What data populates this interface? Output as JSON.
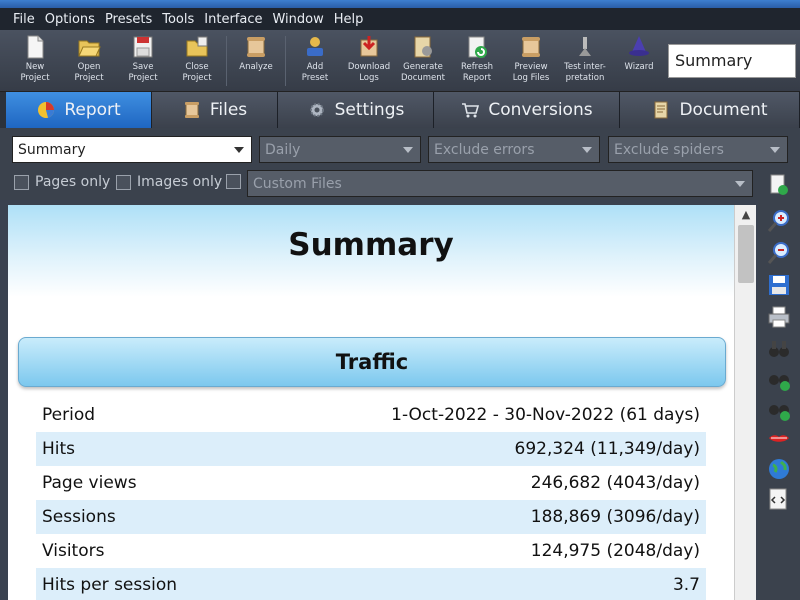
{
  "menu": [
    "File",
    "Options",
    "Presets",
    "Tools",
    "Interface",
    "Window",
    "Help"
  ],
  "toolbar": {
    "buttons": [
      {
        "label": "New\nProject",
        "icon": "new-project-icon"
      },
      {
        "label": "Open\nProject",
        "icon": "open-project-icon"
      },
      {
        "label": "Save\nProject",
        "icon": "save-project-icon"
      },
      {
        "label": "Close\nProject",
        "icon": "close-project-icon"
      },
      {
        "label": "Analyze",
        "icon": "analyze-icon"
      },
      {
        "label": "Add\nPreset",
        "icon": "add-preset-icon"
      },
      {
        "label": "Download\nLogs",
        "icon": "download-logs-icon"
      },
      {
        "label": "Generate\nDocument",
        "icon": "generate-document-icon"
      },
      {
        "label": "Refresh\nReport",
        "icon": "refresh-report-icon"
      },
      {
        "label": "Preview\nLog Files",
        "icon": "preview-log-files-icon"
      },
      {
        "label": "Test inter-\npretation",
        "icon": "test-interpretation-icon"
      },
      {
        "label": "Wizard",
        "icon": "wizard-icon"
      }
    ],
    "report_select_value": "Summary"
  },
  "tabs": [
    {
      "label": "Report",
      "icon": "report-pie-icon",
      "active": true
    },
    {
      "label": "Files",
      "icon": "files-icon",
      "active": false
    },
    {
      "label": "Settings",
      "icon": "settings-gear-icon",
      "active": false
    },
    {
      "label": "Conversions",
      "icon": "cart-icon",
      "active": false
    },
    {
      "label": "Document",
      "icon": "document-icon",
      "active": false
    }
  ],
  "filters": {
    "report_type": "Summary",
    "period": "Daily",
    "errors": "Exclude errors",
    "spiders": "Exclude spiders",
    "pages_only": "Pages only",
    "images_only": "Images only",
    "custom_files": "Custom Files"
  },
  "content": {
    "title": "Summary",
    "section_title": "Traffic",
    "rows": [
      {
        "label": "Period",
        "value": "1-Oct-2022 - 30-Nov-2022 (61 days)"
      },
      {
        "label": "Hits",
        "value": "692,324 (11,349/day)"
      },
      {
        "label": "Page views",
        "value": "246,682 (4043/day)"
      },
      {
        "label": "Sessions",
        "value": "188,869 (3096/day)"
      },
      {
        "label": "Visitors",
        "value": "124,975 (2048/day)"
      },
      {
        "label": "Hits per session",
        "value": "3.7"
      }
    ]
  },
  "rail": [
    "export-file-icon",
    "zoom-in-icon",
    "zoom-out-icon",
    "save-disk-icon",
    "print-icon",
    "binoculars-icon",
    "find-next-icon",
    "find-previous-icon",
    "highlight-lips-icon",
    "globe-icon",
    "html-code-icon"
  ],
  "colors": {
    "active_tab": "#2f7bd6",
    "header_gradient": "#aee0f7",
    "row_shade": "#dceefa"
  }
}
